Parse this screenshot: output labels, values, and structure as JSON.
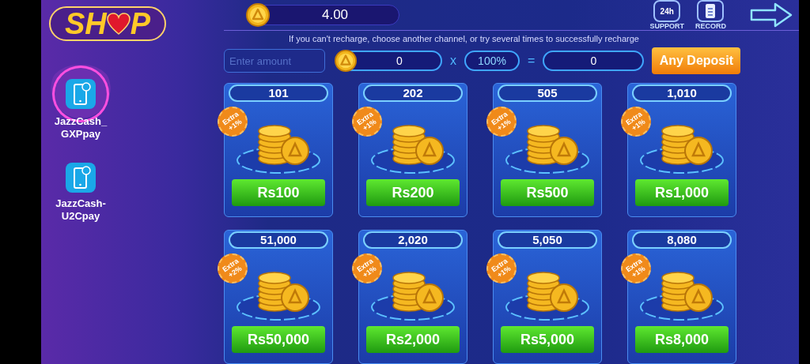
{
  "logo": {
    "left": "SH",
    "right": "P"
  },
  "balance": "4.00",
  "header_buttons": [
    {
      "kind": "support",
      "icon_text": "24h",
      "label": "SUPPORT"
    },
    {
      "kind": "record",
      "label": "RECORD"
    }
  ],
  "channels": [
    {
      "label_lines": [
        "JazzCash_",
        "GXPpay"
      ],
      "selected": true
    },
    {
      "label_lines": [
        "JazzCash-",
        "U2Cpay"
      ],
      "selected": false
    }
  ],
  "notice": "If you can't recharge, choose another channel, or try several times to successfully recharge",
  "calculator": {
    "placeholder": "Enter amount",
    "coins": "0",
    "times": "x",
    "rate": "100%",
    "equals": "=",
    "result": "0",
    "button": "Any Deposit"
  },
  "packages": [
    {
      "coins": "101",
      "badge": [
        "Extra",
        "+1%"
      ],
      "price": "Rs100"
    },
    {
      "coins": "202",
      "badge": [
        "Extra",
        "+1%"
      ],
      "price": "Rs200"
    },
    {
      "coins": "505",
      "badge": [
        "Extra",
        "+1%"
      ],
      "price": "Rs500"
    },
    {
      "coins": "1,010",
      "badge": [
        "Extra",
        "+1%"
      ],
      "price": "Rs1,000"
    },
    {
      "coins": "51,000",
      "badge": [
        "Extra",
        "+2%"
      ],
      "price": "Rs50,000"
    },
    {
      "coins": "2,020",
      "badge": [
        "Extra",
        "+1%"
      ],
      "price": "Rs2,000"
    },
    {
      "coins": "5,050",
      "badge": [
        "Extra",
        "+1%"
      ],
      "price": "Rs5,000"
    },
    {
      "coins": "8,080",
      "badge": [
        "Extra",
        "+1%"
      ],
      "price": "Rs8,000"
    }
  ]
}
